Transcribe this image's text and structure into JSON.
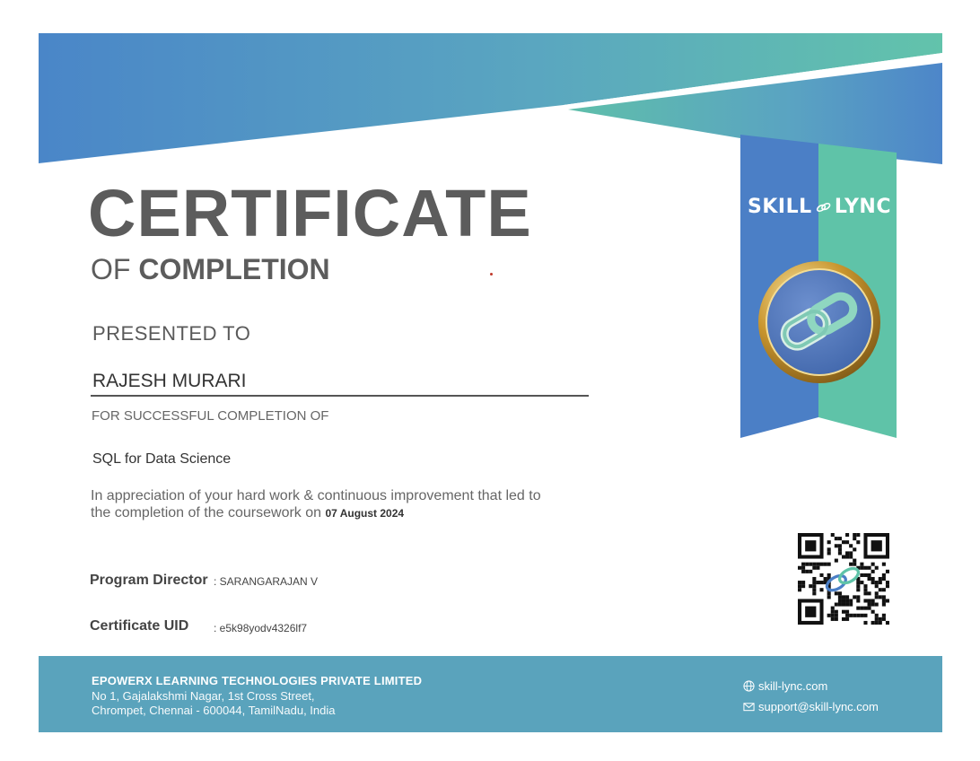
{
  "header": {
    "title": "CERTIFICATE",
    "subtitle_thin": "OF",
    "subtitle_bold": "COMPLETION"
  },
  "brand": {
    "name_left": "SKILL",
    "name_right": "LYNC",
    "link_icon": "chain-link-icon",
    "colors": {
      "blue": "#4b7fc6",
      "teal": "#5fc3a8",
      "gold": "#b8892f",
      "footer": "#5aa3bc"
    }
  },
  "body": {
    "presented_label": "PRESENTED TO",
    "recipient_name": "RAJESH MURARI",
    "for_label": "FOR SUCCESSFUL COMPLETION OF",
    "course_name": "SQL for Data Science",
    "appreciation_line1": "In appreciation of your hard work & continuous improvement that led to",
    "appreciation_line2": "the completion of the coursework on",
    "completion_date": "07 August 2024"
  },
  "details": {
    "director_label": "Program Director",
    "director_value": ": SARANGARAJAN V",
    "uid_label": "Certificate UID",
    "uid_value": ": e5k98yodv4326lf7"
  },
  "footer": {
    "company": "EPOWERX LEARNING TECHNOLOGIES PRIVATE LIMITED",
    "address_line1": "No 1, Gajalakshmi Nagar, 1st Cross Street,",
    "address_line2": "Chrompet, Chennai - 600044, TamilNadu, India",
    "website": "skill-lync.com",
    "email": "support@skill-lync.com",
    "website_icon": "globe-icon",
    "email_icon": "envelope-icon"
  }
}
